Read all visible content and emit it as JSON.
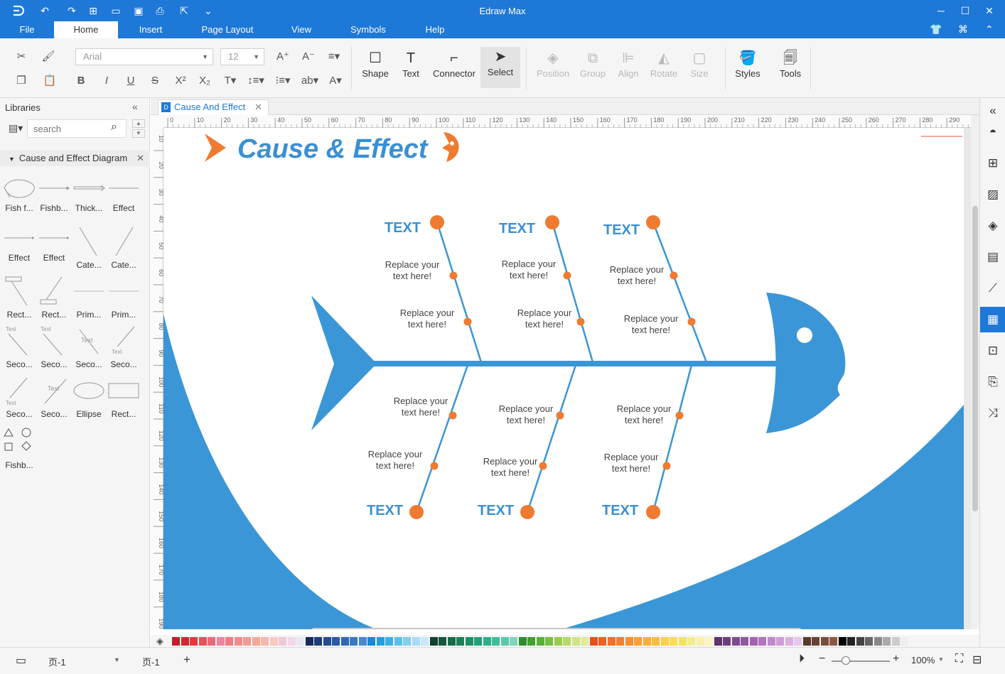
{
  "app": {
    "title": "Edraw Max"
  },
  "menu": {
    "items": [
      "File",
      "Home",
      "Insert",
      "Page Layout",
      "View",
      "Symbols",
      "Help"
    ],
    "active": "Home"
  },
  "ribbon": {
    "font_name": "Arial",
    "font_size": "12",
    "tools": {
      "shape": "Shape",
      "text": "Text",
      "connector": "Connector",
      "select": "Select",
      "position": "Position",
      "group": "Group",
      "align": "Align",
      "rotate": "Rotate",
      "size": "Size",
      "styles": "Styles",
      "tools": "Tools"
    }
  },
  "libraries": {
    "title": "Libraries",
    "search_placeholder": "search",
    "category": "Cause and Effect Diagram",
    "shapes": [
      "Fish f...",
      "Fishb...",
      "Thick...",
      "Effect",
      "Effect",
      "Effect",
      "Cate...",
      "Cate...",
      "Rect...",
      "Rect...",
      "Prim...",
      "Prim...",
      "Seco...",
      "Seco...",
      "Seco...",
      "Seco...",
      "Seco...",
      "Seco...",
      "Ellipse",
      "Rect...",
      "Fishb..."
    ],
    "mini_text": "Text"
  },
  "document": {
    "tab": "Cause And Effect"
  },
  "ruler": {
    "h": [
      "0",
      "10",
      "20",
      "30",
      "40",
      "50",
      "60",
      "70",
      "80",
      "90",
      "100",
      "110",
      "120",
      "130",
      "140",
      "150",
      "160",
      "170",
      "180",
      "190",
      "200",
      "210",
      "220",
      "230",
      "240",
      "250",
      "260",
      "270",
      "280",
      "290"
    ],
    "v": [
      "10",
      "20",
      "30",
      "40",
      "50",
      "60",
      "70",
      "80",
      "90",
      "100",
      "110",
      "120",
      "130",
      "140",
      "150",
      "160",
      "170",
      "180",
      "190"
    ]
  },
  "diagram": {
    "title": "Cause & Effect",
    "colors": {
      "blue": "#3a96d6",
      "orange": "#ee7b30",
      "title_blue": "#3a8fd4"
    },
    "category_labels": [
      "TEXT",
      "TEXT",
      "TEXT",
      "TEXT",
      "TEXT",
      "TEXT"
    ],
    "cause_line1": "Replace your",
    "cause_line2": "text here!"
  },
  "status": {
    "page_selector": "页-1",
    "page_tab": "页-1",
    "zoom": "100%"
  },
  "palette": [
    "#c0202a",
    "#d4262f",
    "#e23a3f",
    "#e6525a",
    "#ea6a7a",
    "#ec86a0",
    "#ee7a82",
    "#f08b8b",
    "#f29a92",
    "#f4a898",
    "#f6b8a8",
    "#f8c8c0",
    "#f0c8d8",
    "#f2d8e8",
    "#e8e8f4",
    "#162a5c",
    "#1d3d7c",
    "#234c92",
    "#2a5aa6",
    "#3068b6",
    "#3a78c4",
    "#4888d0",
    "#1888d8",
    "#20a0e0",
    "#38b0e8",
    "#58c0ec",
    "#80cef0",
    "#a8dcf4",
    "#c8e8f8",
    "#124030",
    "#14583c",
    "#186c48",
    "#1a8058",
    "#1e9068",
    "#22a07a",
    "#2cb08a",
    "#40bc9a",
    "#5cc8aa",
    "#80d4bc",
    "#2e8c2c",
    "#40a030",
    "#58b038",
    "#78c040",
    "#98cc50",
    "#b8d868",
    "#d0e488",
    "#e0ec9c",
    "#e85020",
    "#ec6024",
    "#f07028",
    "#f4802c",
    "#f69030",
    "#f8a034",
    "#faae38",
    "#fcbe3c",
    "#fcd040",
    "#f8de50",
    "#f0e460",
    "#f4ec88",
    "#f8f0a8",
    "#fcf4c0",
    "#603070",
    "#703c80",
    "#804890",
    "#9056a0",
    "#a064b0",
    "#b074c0",
    "#c088cc",
    "#d09cd8",
    "#dcb0e0",
    "#e8c8ec",
    "#5a3a2a",
    "#6a4232",
    "#7a4c3a",
    "#8c5a44",
    "#000000",
    "#222222",
    "#444444",
    "#666666",
    "#888888",
    "#aaaaaa",
    "#cccccc",
    "#eeeeee"
  ]
}
